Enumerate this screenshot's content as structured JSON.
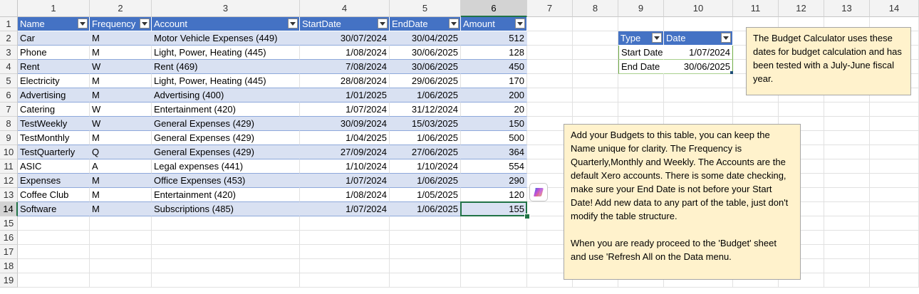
{
  "column_headers": [
    "1",
    "2",
    "3",
    "4",
    "5",
    "6",
    "7",
    "8",
    "9",
    "10",
    "11",
    "12",
    "13",
    "14"
  ],
  "row_headers": [
    "1",
    "2",
    "3",
    "4",
    "5",
    "6",
    "7",
    "8",
    "9",
    "10",
    "11",
    "12",
    "13",
    "14",
    "15",
    "16",
    "17",
    "18",
    "19"
  ],
  "budget_table": {
    "columns": [
      "Name",
      "Frequency",
      "Account",
      "StartDate",
      "EndDate",
      "Amount"
    ],
    "rows": [
      [
        "Car",
        "M",
        "Motor Vehicle Expenses (449)",
        "30/07/2024",
        "30/04/2025",
        "512"
      ],
      [
        "Phone",
        "M",
        "Light, Power, Heating (445)",
        "1/08/2024",
        "30/06/2025",
        "128"
      ],
      [
        "Rent",
        "W",
        "Rent (469)",
        "7/08/2024",
        "30/06/2025",
        "450"
      ],
      [
        "Electricity",
        "M",
        "Light, Power, Heating (445)",
        "28/08/2024",
        "29/06/2025",
        "170"
      ],
      [
        "Advertising",
        "M",
        "Advertising (400)",
        "1/01/2025",
        "1/06/2025",
        "200"
      ],
      [
        "Catering",
        "W",
        "Entertainment (420)",
        "1/07/2024",
        "31/12/2024",
        "20"
      ],
      [
        "TestWeekly",
        "W",
        "General Expenses (429)",
        "30/09/2024",
        "15/03/2025",
        "150"
      ],
      [
        "TestMonthly",
        "M",
        "General Expenses (429)",
        "1/04/2025",
        "1/06/2025",
        "500"
      ],
      [
        "TestQuarterly",
        "Q",
        "General Expenses (429)",
        "27/09/2024",
        "27/06/2025",
        "364"
      ],
      [
        "ASIC",
        "A",
        "Legal expenses (441)",
        "1/10/2024",
        "1/10/2024",
        "554"
      ],
      [
        "Expenses",
        "M",
        "Office Expenses (453)",
        "1/07/2024",
        "1/06/2025",
        "290"
      ],
      [
        "Coffee Club",
        "M",
        "Entertainment (420)",
        "1/08/2024",
        "1/05/2025",
        "120"
      ],
      [
        "Software",
        "M",
        "Subscriptions (485)",
        "1/07/2024",
        "1/06/2025",
        "155"
      ]
    ]
  },
  "date_table": {
    "columns": [
      "Type",
      "Date"
    ],
    "rows": [
      [
        "Start Date",
        "1/07/2024"
      ],
      [
        "End Date",
        "30/06/2025"
      ]
    ]
  },
  "notes": {
    "fiscal_note": "The Budget Calculator uses these dates for budget calculation and has been tested with a July-June fiscal year.",
    "instructions_note": "Add your Budgets to this table, you can keep the Name unique for clarity. The Frequency is Quarterly,Monthly and Weekly. The Accounts are the default Xero accounts. There is some date checking, make sure your End Date is not before your Start Date! Add new data to any part of the table, just don't modify the table structure.\n\nWhen you are ready proceed to the 'Budget' sheet and use 'Refresh All on the Data menu."
  },
  "selected": {
    "column": "6",
    "row": "14"
  },
  "colors": {
    "header": "#4472c4",
    "band": "#d9e1f2",
    "note": "#fff2cc",
    "selection": "#217346"
  },
  "icons": {
    "filter": "filter-dropdown-icon",
    "copilot": "copilot-icon"
  }
}
